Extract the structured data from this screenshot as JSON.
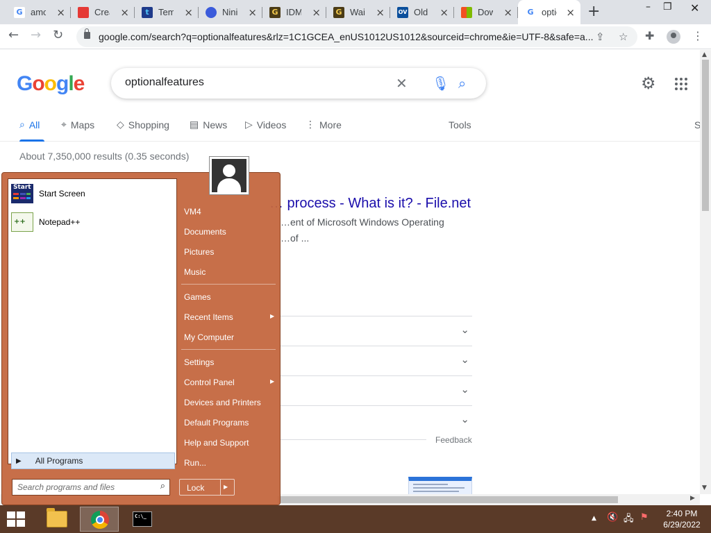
{
  "browser": {
    "tabs": [
      {
        "title": "amo",
        "fav_color": "#ffffff",
        "fav_text": "G",
        "fav_text_color": "#4285f4"
      },
      {
        "title": "Crea",
        "fav_color": "#e53935",
        "fav_text": "",
        "fav_text_color": "#ffffff"
      },
      {
        "title": "Temp",
        "fav_color": "#1e3a8a",
        "fav_text": "t",
        "fav_text_color": "#4fc3f7"
      },
      {
        "title": "Ninit",
        "fav_color": "#3b5bdb",
        "fav_text": "",
        "fav_text_color": "#ffffff"
      },
      {
        "title": "IDM",
        "fav_color": "#4a3b16",
        "fav_text": "G",
        "fav_text_color": "#f2c94c"
      },
      {
        "title": "Wait",
        "fav_color": "#4a3b16",
        "fav_text": "G",
        "fav_text_color": "#f2c94c"
      },
      {
        "title": "Old v",
        "fav_color": "#0b4f9c",
        "fav_text": "OV",
        "fav_text_color": "#ffffff"
      },
      {
        "title": "Dow",
        "fav_color": "#ffffff",
        "fav_text": "",
        "fav_text_color": "#ffffff"
      },
      {
        "title": "optic",
        "fav_color": "#ffffff",
        "fav_text": "G",
        "fav_text_color": "#4285f4"
      }
    ],
    "url": "google.com/search?q=optionalfeatures&rlz=1C1GCEA_enUS1012US1012&sourceid=chrome&ie=UTF-8&safe=a..."
  },
  "google": {
    "logo": "Google",
    "query": "optionalfeatures",
    "nav": {
      "all": "All",
      "maps": "Maps",
      "shopping": "Shopping",
      "news": "News",
      "videos": "Videos",
      "more": "More",
      "tools": "Tools",
      "s": "S"
    },
    "stats": "About 7,350,000 results (0.35 seconds)",
    "result_title": "… process - What is it? - File.net",
    "result_snippet_1": "…ent of Microsoft Windows Operating",
    "result_snippet_2": "…of ...",
    "feedback": "Feedback"
  },
  "start_menu": {
    "programs": [
      {
        "label": "Start Screen",
        "icon": "start-screen-icon"
      },
      {
        "label": "Notepad++",
        "icon": "notepad-plus-plus-icon"
      }
    ],
    "all_programs": "All Programs",
    "search_placeholder": "Search programs and files",
    "right": {
      "user": "VM4",
      "documents": "Documents",
      "pictures": "Pictures",
      "music": "Music",
      "games": "Games",
      "recent_items": "Recent Items",
      "my_computer": "My Computer",
      "settings": "Settings",
      "control_panel": "Control Panel",
      "devices_printers": "Devices and Printers",
      "default_programs": "Default Programs",
      "help_support": "Help and Support",
      "run": "Run..."
    },
    "lock": "Lock"
  },
  "taskbar": {
    "time": "2:40 PM",
    "date": "6/29/2022",
    "apps": [
      "file-explorer-icon",
      "chrome-icon",
      "command-prompt-icon"
    ]
  },
  "colors": {
    "accent_blue": "#1a73e8",
    "start_menu_bg": "#c4663e",
    "taskbar_bg": "#5a3a28",
    "link": "#1a0dab"
  }
}
